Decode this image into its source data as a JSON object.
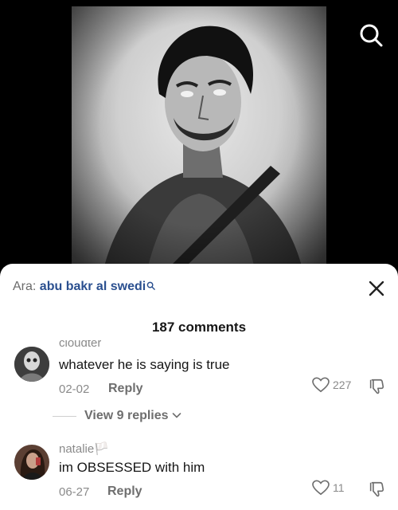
{
  "search_suggestion": {
    "prefix": "Ara:",
    "term": "abu bakr al swedi"
  },
  "comments_header": {
    "count_label": "187 comments"
  },
  "comments": [
    {
      "username": "cloudter",
      "text": "whatever he is saying is true",
      "date": "02-02",
      "reply_label": "Reply",
      "likes": "227"
    },
    {
      "username": "natalie🏳️",
      "text": "im OBSESSED with him",
      "date": "06-27",
      "reply_label": "Reply",
      "likes": "11"
    }
  ],
  "view_replies": {
    "label": "View 9 replies"
  },
  "icons": {
    "search": "search-icon",
    "close": "close-icon",
    "heart": "heart-icon",
    "dislike": "thumbs-down-icon",
    "chevron": "chevron-down-icon"
  }
}
